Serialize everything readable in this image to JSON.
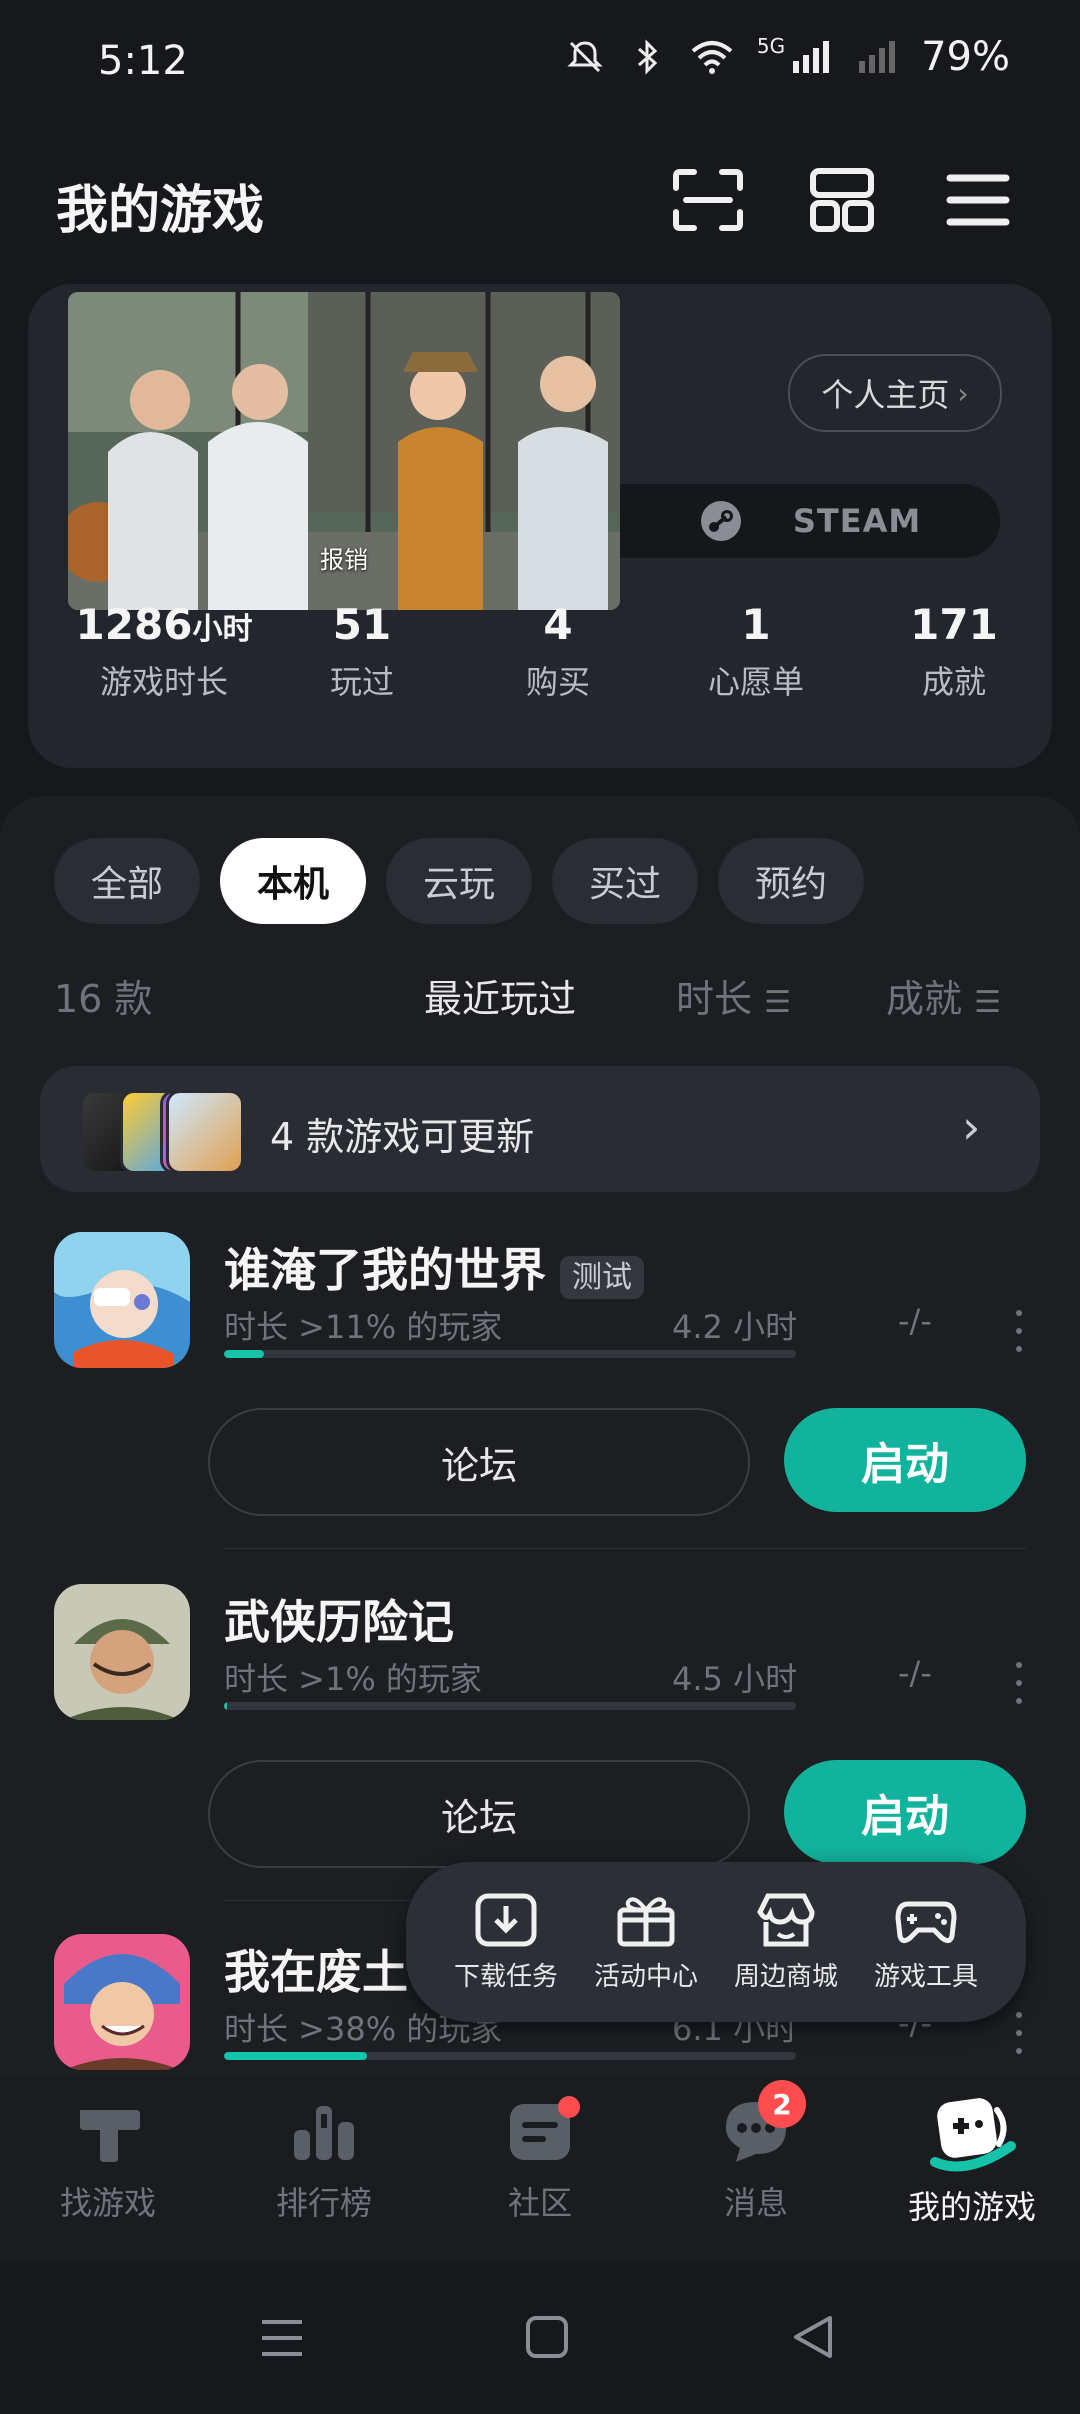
{
  "status_bar": {
    "time": "5:12",
    "network": "5G",
    "battery": "79%"
  },
  "header": {
    "title": "我的游戏"
  },
  "profile": {
    "home_button": "个人主页",
    "steam_label": "STEAM",
    "video_caption": "报销",
    "stats": [
      {
        "value": "1286",
        "unit": "小时",
        "label": "游戏时长"
      },
      {
        "value": "51",
        "unit": "",
        "label": "玩过"
      },
      {
        "value": "4",
        "unit": "",
        "label": "购买"
      },
      {
        "value": "1",
        "unit": "",
        "label": "心愿单"
      },
      {
        "value": "171",
        "unit": "",
        "label": "成就"
      }
    ]
  },
  "tabs": [
    "全部",
    "本机",
    "云玩",
    "买过",
    "预约"
  ],
  "active_tab": "本机",
  "sort": {
    "count": "16 款",
    "recent": "最近玩过",
    "duration": "时长",
    "achievements": "成就"
  },
  "update_banner": {
    "text": "4 款游戏可更新"
  },
  "games": [
    {
      "title": "谁淹了我的世界",
      "badge": "测试",
      "meta": "时长 >11% 的玩家",
      "hours": "4.2 小时",
      "dash": "-/-",
      "progress": 0.07,
      "forum": "论坛",
      "launch": "启动"
    },
    {
      "title": "武侠历险记",
      "badge": "",
      "meta": "时长 >1% 的玩家",
      "hours": "4.5 小时",
      "dash": "-/-",
      "progress": 0.005,
      "forum": "论坛",
      "launch": "启动"
    },
    {
      "title": "我在废土",
      "badge": "",
      "meta": "时长 >38% 的玩家",
      "hours": "6.1 小时",
      "dash": "-/-",
      "progress": 0.25
    }
  ],
  "quick_menu": [
    {
      "label": "下载任务",
      "icon": "download-icon"
    },
    {
      "label": "活动中心",
      "icon": "gift-icon"
    },
    {
      "label": "周边商城",
      "icon": "store-icon"
    },
    {
      "label": "游戏工具",
      "icon": "gamepad-icon"
    }
  ],
  "bottom_nav": [
    {
      "label": "找游戏",
      "icon": "taptap-logo-icon"
    },
    {
      "label": "排行榜",
      "icon": "ranking-icon"
    },
    {
      "label": "社区",
      "icon": "community-icon",
      "dot": true
    },
    {
      "label": "消息",
      "icon": "message-icon",
      "badge": "2"
    },
    {
      "label": "我的游戏",
      "icon": "my-games-icon",
      "active": true
    }
  ],
  "colors": {
    "accent": "#12b39d",
    "badge": "#ff4d4f",
    "background": "#16181c"
  }
}
